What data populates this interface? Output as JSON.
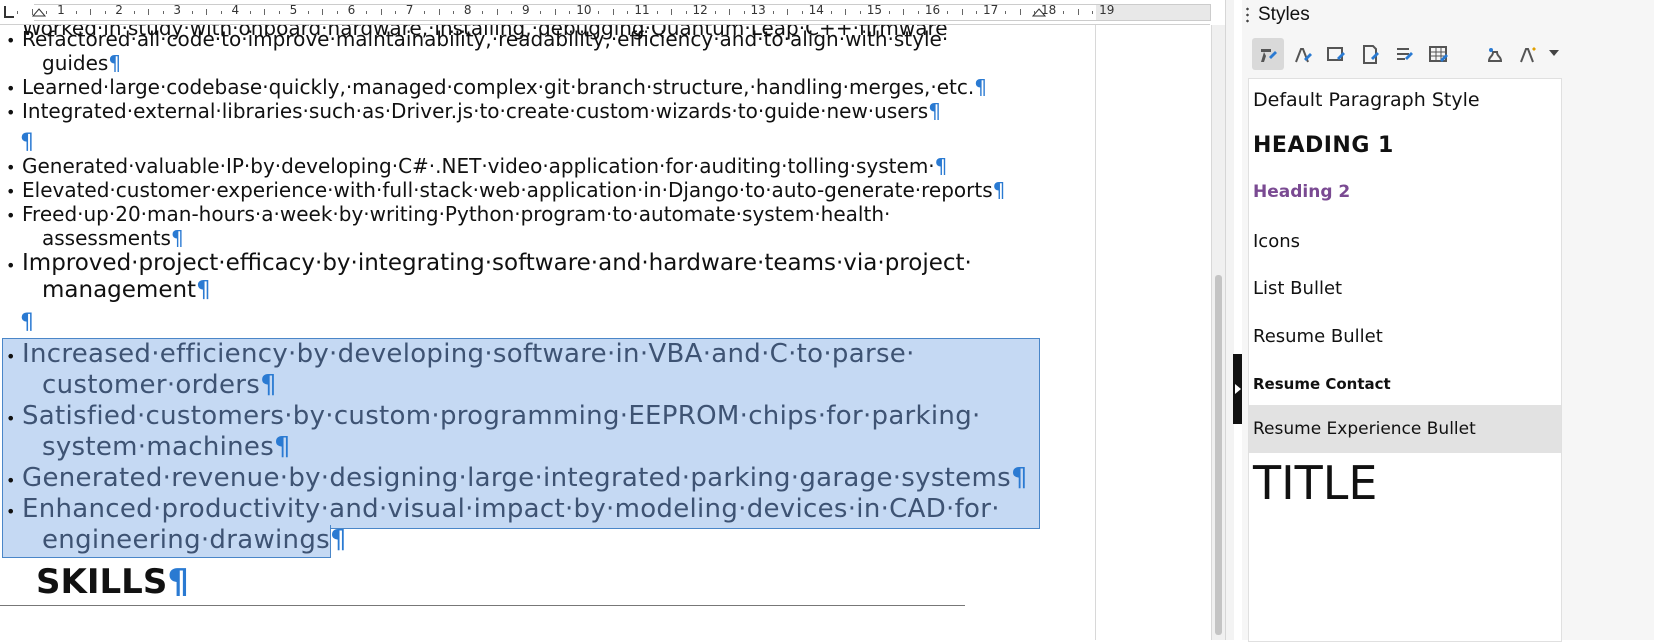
{
  "ruler": {
    "numbers": [
      "1",
      "2",
      "3",
      "4",
      "5",
      "6",
      "7",
      "8",
      "9",
      "10",
      "11",
      "12",
      "13",
      "14",
      "15",
      "16",
      "17",
      "18",
      "19"
    ]
  },
  "document": {
    "top_cut_text": "·········································································································································",
    "paragraphs": [
      {
        "bullet": "•",
        "lines": [
          "Refactored·all·code·to·improve·maintainability,·readability,·efficiency·and·to·align·with·style·",
          "guides"
        ],
        "pilcrow": "¶"
      },
      {
        "bullet": "•",
        "lines": [
          "Learned·large·codebase·quickly,·managed·complex·git·branch·structure,·handling·merges,·etc."
        ],
        "pilcrow": "¶"
      },
      {
        "bullet": "•",
        "lines": [
          "Integrated·external·libraries·such·as·Driver.js·to·create·custom·wizards·to·guide·new·users"
        ],
        "pilcrow": "¶"
      },
      {
        "bullet": "•",
        "lines": [
          "Generated·valuable·IP·by·developing·C#·.NET·video·application·for·auditing·tolling·system·"
        ],
        "pilcrow": "¶"
      },
      {
        "bullet": "•",
        "lines": [
          "Elevated·customer·experience·with·full·stack·web·application·in·Django·to·auto-generate·reports"
        ],
        "pilcrow": "¶"
      },
      {
        "bullet": "•",
        "lines": [
          "Freed·up·20·man-hours·a·week·by·writing·Python·program·to·automate·system·health·",
          "assessments"
        ],
        "pilcrow": "¶"
      },
      {
        "bullet": "•",
        "lines": [
          "Improved·project·efficacy·by·integrating·software·and·hardware·teams·via·project·",
          "management"
        ],
        "pilcrow": "¶"
      },
      {
        "bullet": "•",
        "lines": [
          "Increased·efficiency·by·developing·software·in·VBA·and·C·to·parse·",
          "customer·orders"
        ],
        "pilcrow": "¶"
      },
      {
        "bullet": "•",
        "lines": [
          "Satisfied·customers·by·custom·programming·EEPROM·chips·for·parking·",
          "system·machines"
        ],
        "pilcrow": "¶"
      },
      {
        "bullet": "•",
        "lines": [
          "Generated·revenue·by·designing·large·integrated·parking·garage·systems"
        ],
        "pilcrow": "¶"
      },
      {
        "bullet": "•",
        "lines": [
          "Enhanced·productivity·and·visual·impact·by·modeling·devices·in·CAD·for·",
          "engineering·drawings"
        ],
        "pilcrow": "¶"
      }
    ],
    "empty_pilcrow": "¶",
    "heading": "SKILLS",
    "heading_pilcrow": "¶"
  },
  "sidebar": {
    "title": "Styles",
    "toolbar": [
      {
        "icon": "paragraph-styles-icon",
        "active": true
      },
      {
        "icon": "character-styles-icon",
        "active": false
      },
      {
        "icon": "frame-styles-icon",
        "active": false
      },
      {
        "icon": "page-styles-icon",
        "active": false
      },
      {
        "icon": "list-styles-icon",
        "active": false
      },
      {
        "icon": "table-styles-icon",
        "active": false
      },
      {
        "icon": "fill-format-mode-icon",
        "active": false
      },
      {
        "icon": "styles-actions-icon",
        "active": false
      }
    ],
    "styles": [
      {
        "label": "Default Paragraph Style"
      },
      {
        "label": "HEADING 1"
      },
      {
        "label": "Heading 2",
        "color": "#7a4a92"
      },
      {
        "label": "Icons"
      },
      {
        "label": "List Bullet"
      },
      {
        "label": "Resume Bullet"
      },
      {
        "label": "Resume Contact"
      },
      {
        "label": "Resume Experience Bullet",
        "selected": true
      },
      {
        "label": "TITLE"
      }
    ]
  },
  "colors": {
    "selection": "#c5d9f3",
    "selection_border": "#4a86c8",
    "pilcrow": "#2a7ad2",
    "selected_text": "#3e5373",
    "heading2": "#7a4a92"
  }
}
